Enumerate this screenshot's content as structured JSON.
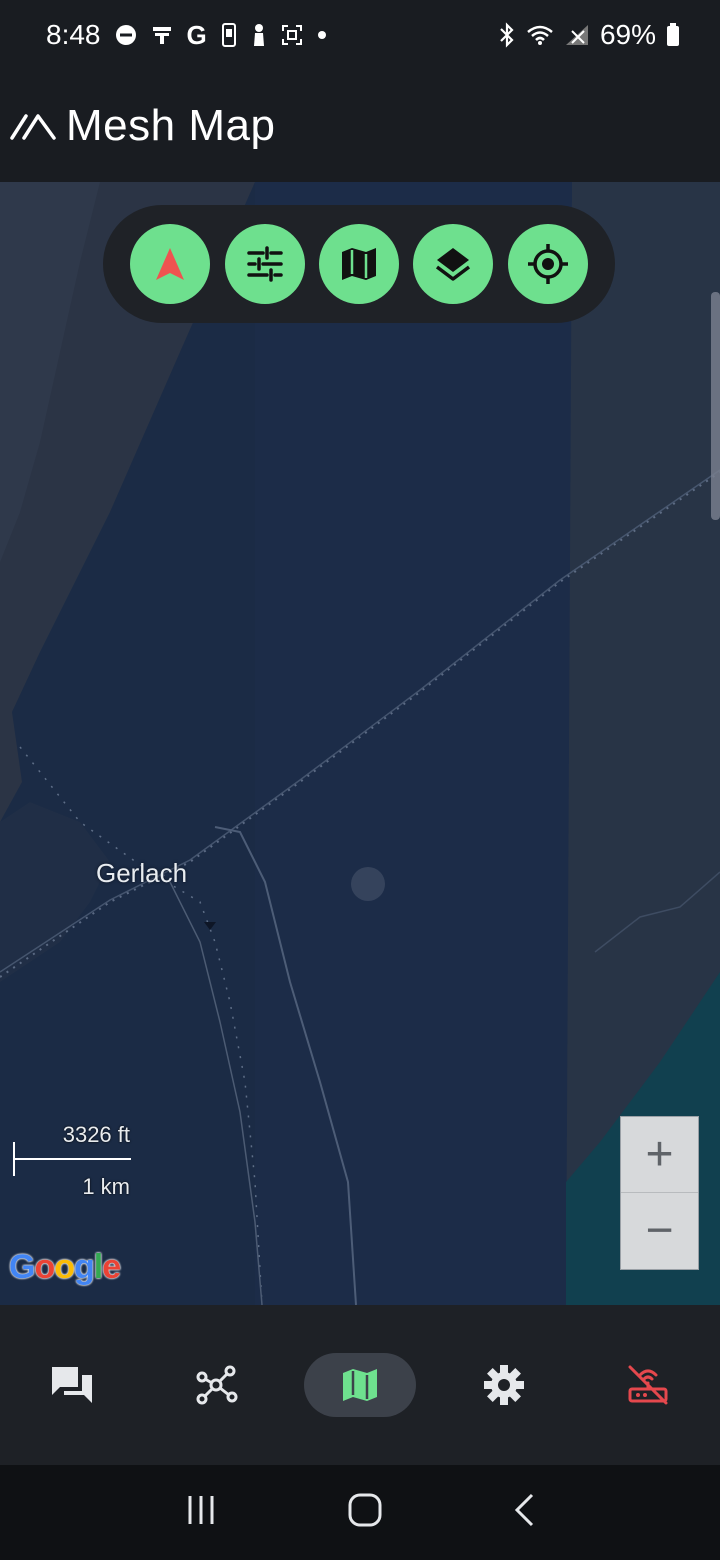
{
  "status_bar": {
    "time": "8:48",
    "battery": "69%",
    "left_icons": [
      "do-not-disturb-icon",
      "notification-icon",
      "google-icon",
      "phone-icon",
      "person-icon",
      "screenshot-icon",
      "dot-icon"
    ],
    "right_icons": [
      "bluetooth-icon",
      "wifi-icon",
      "no-signal-icon",
      "battery-icon"
    ]
  },
  "app_bar": {
    "title": "Mesh Map",
    "logo_icon": "meshtastic-logo-icon"
  },
  "map_toolbar": {
    "buttons": [
      "navigation-arrow-icon",
      "filter-sliders-icon",
      "map-type-icon",
      "layers-icon",
      "my-location-icon"
    ],
    "accent": "#6EE08E"
  },
  "map": {
    "place_label": "Gerlach",
    "scale_imperial": "3326 ft",
    "scale_metric": "1 km",
    "attribution": "Google",
    "zoom_in": "+",
    "zoom_out": "−"
  },
  "bottom_nav": {
    "items": [
      "messages-icon",
      "nodes-icon",
      "map-icon",
      "settings-icon",
      "disconnected-router-icon"
    ],
    "active": "map-icon",
    "disconnected_color": "#E5484D"
  },
  "system_nav": {
    "items": [
      "recent-apps-icon",
      "home-icon",
      "back-icon"
    ]
  }
}
